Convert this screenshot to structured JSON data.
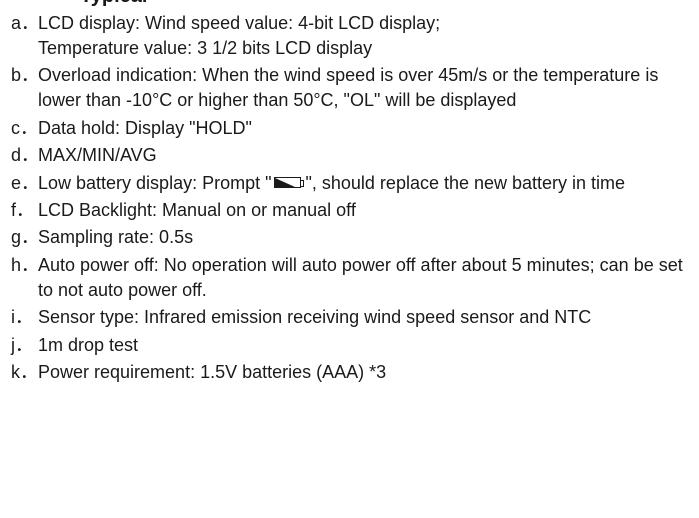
{
  "heading": "Typical",
  "items": [
    {
      "letter": "a．",
      "text": "LCD display: Wind speed value: 4-bit LCD display;\nTemperature value: 3 1/2 bits LCD display"
    },
    {
      "letter": "b．",
      "text": "Overload indication: When the wind speed is over 45m/s or the temperature is lower than -10°C or higher than 50°C, \"OL\" will be displayed"
    },
    {
      "letter": "c．",
      "text": "Data hold: Display \"HOLD\""
    },
    {
      "letter": "d．",
      "text": "MAX/MIN/AVG"
    },
    {
      "letter": "e．",
      "text_before": "Low battery display: Prompt \"",
      "text_after": "\", should replace the new battery in time",
      "icon": "low-battery-icon"
    },
    {
      "letter": "f．",
      "text": "LCD Backlight: Manual on or manual off"
    },
    {
      "letter": "g．",
      "text": "Sampling rate: 0.5s"
    },
    {
      "letter": "h．",
      "text": "Auto power off: No operation will auto power off after about 5 minutes; can be set to not auto power off."
    },
    {
      "letter": "i．",
      "text": "Sensor type: Infrared emission receiving wind speed sensor and NTC"
    },
    {
      "letter": "j．",
      "text": "1m drop test"
    },
    {
      "letter": "k．",
      "text": "Power requirement: 1.5V batteries (AAA) *3"
    }
  ]
}
